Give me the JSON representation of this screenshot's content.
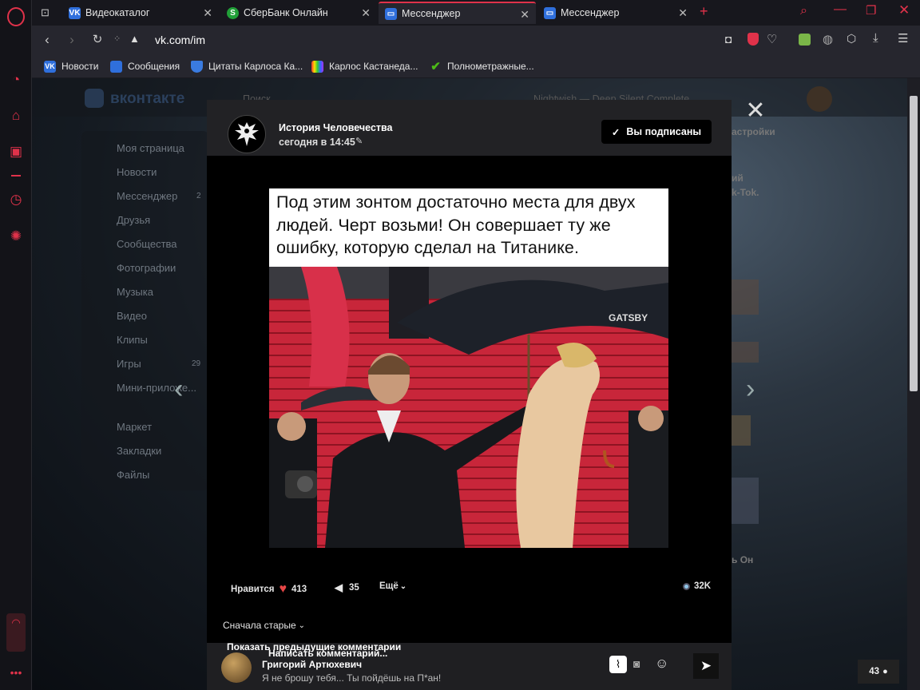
{
  "tabs": [
    {
      "label": "Видеокаталог",
      "fav_color": "#2f6fdc",
      "fav_text": "VK",
      "active": false
    },
    {
      "label": "СберБанк Онлайн",
      "fav_color": "#21a038",
      "fav_text": "S",
      "active": false
    },
    {
      "label": "Мессенджер",
      "fav_color": "#2f6fdc",
      "fav_text": "",
      "active": true
    },
    {
      "label": "Мессенджер",
      "fav_color": "#2f6fdc",
      "fav_text": "",
      "active": false
    }
  ],
  "address": {
    "url": "vk.com/im"
  },
  "bookmarks": [
    {
      "label": "Новости",
      "color": "#2f6fdc",
      "text": "VK"
    },
    {
      "label": "Сообщения",
      "color": "#2f6fdc",
      "text": ""
    },
    {
      "label": "Цитаты Карлоса Ка...",
      "color": "#3a7be0",
      "text": ""
    },
    {
      "label": "Карлос Кастанеда...",
      "color": "#6a3adc",
      "text": ""
    },
    {
      "label": "Полнометражные...",
      "color": "#4cbb17",
      "text": "✔"
    }
  ],
  "vk_menu": [
    {
      "label": "Моя страница",
      "count": ""
    },
    {
      "label": "Новости",
      "count": ""
    },
    {
      "label": "Мессенджер",
      "count": "2"
    },
    {
      "label": "Друзья",
      "count": ""
    },
    {
      "label": "Сообщества",
      "count": ""
    },
    {
      "label": "Фотографии",
      "count": ""
    },
    {
      "label": "Музыка",
      "count": ""
    },
    {
      "label": "Видео",
      "count": ""
    },
    {
      "label": "Клипы",
      "count": ""
    },
    {
      "label": "Игры",
      "count": "29"
    },
    {
      "label": "Мини-приложе...",
      "count": ""
    },
    {
      "label": "Маркет",
      "count": ""
    },
    {
      "label": "Закладки",
      "count": ""
    },
    {
      "label": "Файлы",
      "count": ""
    }
  ],
  "vk_header": {
    "logo": "вконтакте",
    "search": "Поиск",
    "player_track": "Nightwish — Deep Silent Complete"
  },
  "background_snippets": {
    "settings": "астройки",
    "line1": "ий",
    "line2": "k-Tok.",
    "line3": "ь Он"
  },
  "post": {
    "author": "История Человечества",
    "time": "сегодня в 14:45",
    "subscribe_label": "Вы подписаны",
    "caption": "Под этим зонтом достаточно места для двух людей. Черт возьми! Он совершает ту же ошибку, которую сделал на Титанике.",
    "umbrella_text": "GATSBY",
    "likes_label": "Нравится",
    "likes_count": "413",
    "shares_count": "35",
    "more_label": "Ещё",
    "views_count": "32K",
    "sort_label": "Сначала старые",
    "show_prev_label": "Показать предыдущие комментарии",
    "comment_placeholder": "Написать комментарий...",
    "comment_author": "Григорий Артюхевич",
    "comment_text": "Я не брошу тебя... Ты пойдёшь на П*ан!"
  },
  "online_count": "43",
  "colors": {
    "accent": "#e0324a",
    "vk_blue": "#2f6fdc",
    "heart": "#e64646"
  }
}
